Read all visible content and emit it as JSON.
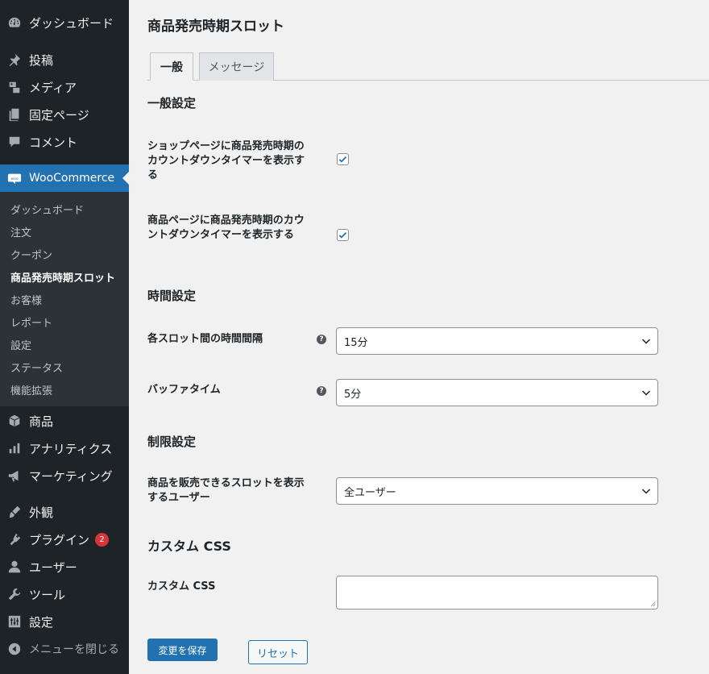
{
  "sidebar": {
    "menu": [
      {
        "label": "ダッシュボード",
        "icon": "dashboard-icon"
      },
      {
        "label": "投稿",
        "icon": "pushpin-icon"
      },
      {
        "label": "メディア",
        "icon": "media-icon"
      },
      {
        "label": "固定ページ",
        "icon": "page-icon"
      },
      {
        "label": "コメント",
        "icon": "comment-icon"
      },
      {
        "label": "WooCommerce",
        "icon": "woo-icon"
      },
      {
        "label": "商品",
        "icon": "product-box-icon"
      },
      {
        "label": "アナリティクス",
        "icon": "analytics-icon"
      },
      {
        "label": "マーケティング",
        "icon": "megaphone-icon"
      },
      {
        "label": "外観",
        "icon": "brush-icon"
      },
      {
        "label": "プラグイン",
        "icon": "plugin-icon",
        "badge": "2"
      },
      {
        "label": "ユーザー",
        "icon": "user-icon"
      },
      {
        "label": "ツール",
        "icon": "wrench-icon"
      },
      {
        "label": "設定",
        "icon": "settings-icon"
      },
      {
        "label": "メニューを閉じる",
        "icon": "collapse-icon"
      }
    ],
    "submenu": [
      "ダッシュボード",
      "注文",
      "クーポン",
      "商品発売時期スロット",
      "お客様",
      "レポート",
      "設定",
      "ステータス",
      "機能拡張"
    ]
  },
  "page": {
    "title": "商品発売時期スロット",
    "tabs": [
      "一般",
      "メッセージ"
    ],
    "sections": {
      "general": "一般設定",
      "time": "時間設定",
      "limit": "制限設定",
      "css": "カスタム CSS"
    },
    "fields": {
      "shop_timer_label": "ショップページに商品発売時期のカウントダウンタイマーを表示する",
      "product_timer_label": "商品ページに商品発売時期のカウントダウンタイマーを表示する",
      "interval_label": "各スロット間の時間間隔",
      "interval_value": "15分",
      "buffer_label": "バッファタイム",
      "buffer_value": "5分",
      "users_label": "商品を販売できるスロットを表示するユーザー",
      "users_value": "全ユーザー",
      "css_label": "カスタム CSS",
      "help": "?"
    },
    "buttons": {
      "save": "変更を保存",
      "reset": "リセット"
    }
  },
  "colors": {
    "sidebar_bg": "#1d2327",
    "submenu_bg": "#2c3338",
    "accent": "#2271b1",
    "badge": "#d63638"
  }
}
